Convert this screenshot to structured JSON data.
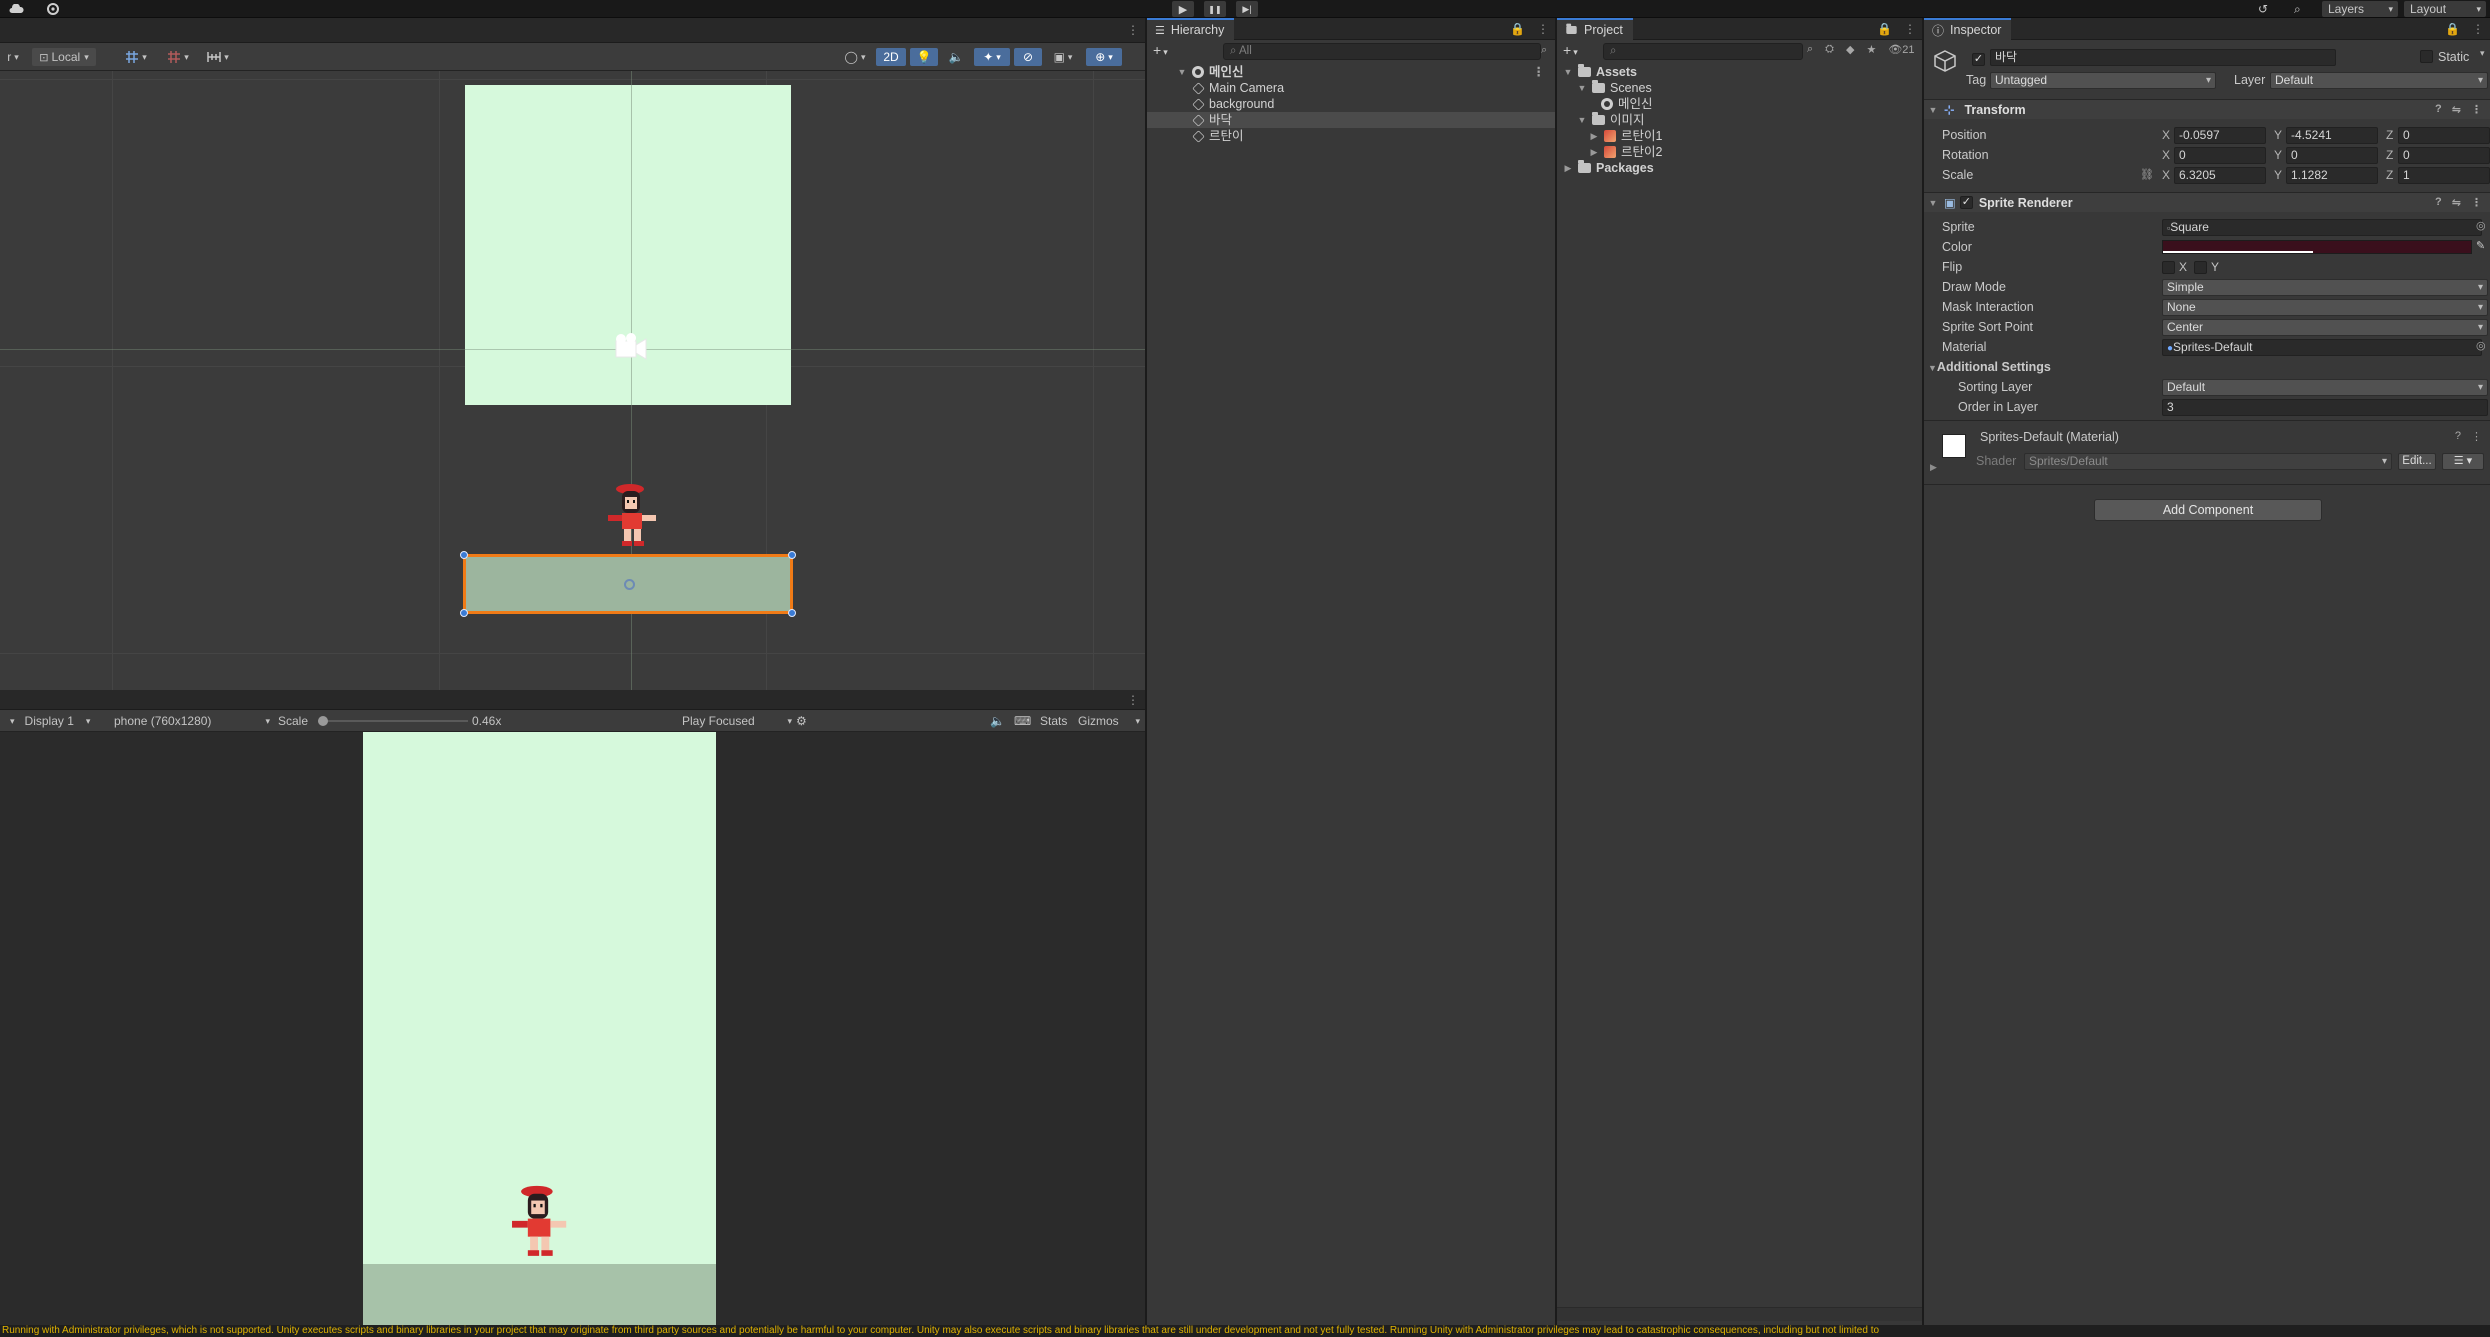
{
  "topbar": {
    "left_icons": [
      "cloud-icon",
      "settings-icon"
    ],
    "play_icon": "▶",
    "pause_icon": "❚❚",
    "step_icon": "▶|",
    "history_icon": "↺",
    "search_icon": "⌕",
    "layers_label": "Layers",
    "layout_label": "Layout"
  },
  "scene": {
    "toolbar": {
      "pivot_partial": "r",
      "local_label": "Local",
      "mode_2d": "2D"
    }
  },
  "game": {
    "display_label": "Display 1",
    "resolution_label": "phone (760x1280)",
    "scale_label": "Scale",
    "scale_value": "0.46x",
    "scale_fraction": 0.0,
    "play_focused_label": "Play Focused",
    "stats_label": "Stats",
    "gizmos_label": "Gizmos"
  },
  "hierarchy": {
    "tab_label": "Hierarchy",
    "search_placeholder": "All",
    "scene_name": "메인신",
    "items": [
      {
        "label": "Main Camera",
        "selected": false
      },
      {
        "label": "background",
        "selected": false
      },
      {
        "label": "바닥",
        "selected": true
      },
      {
        "label": "르탄이",
        "selected": false
      }
    ]
  },
  "project": {
    "tab_label": "Project",
    "hidden_count": "21",
    "tree": {
      "assets": "Assets",
      "scenes": "Scenes",
      "scene_file": "메인신",
      "images": "이미지",
      "image_files": [
        "르탄이1",
        "르탄이2"
      ],
      "packages": "Packages"
    }
  },
  "inspector": {
    "tab_label": "Inspector",
    "object_name": "바닥",
    "static_label": "Static",
    "tag_label": "Tag",
    "tag_value": "Untagged",
    "layer_label": "Layer",
    "layer_value": "Default",
    "transform": {
      "title": "Transform",
      "position_label": "Position",
      "rotation_label": "Rotation",
      "scale_label": "Scale",
      "position": {
        "x": "-0.0597",
        "y": "-4.5241",
        "z": "0"
      },
      "rotation": {
        "x": "0",
        "y": "0",
        "z": "0"
      },
      "scale": {
        "x": "6.3205",
        "y": "1.1282",
        "z": "1"
      }
    },
    "sprite_renderer": {
      "title": "Sprite Renderer",
      "sprite_label": "Sprite",
      "sprite_value": "Square",
      "color_label": "Color",
      "color_hex": "#3a0f1c",
      "flip_label": "Flip",
      "flip_x": "X",
      "flip_y": "Y",
      "draw_mode_label": "Draw Mode",
      "draw_mode_value": "Simple",
      "mask_label": "Mask Interaction",
      "mask_value": "None",
      "sort_point_label": "Sprite Sort Point",
      "sort_point_value": "Center",
      "material_label": "Material",
      "material_value": "Sprites-Default",
      "additional_label": "Additional Settings",
      "sorting_layer_label": "Sorting Layer",
      "sorting_layer_value": "Default",
      "order_label": "Order in Layer",
      "order_value": "3"
    },
    "material": {
      "title": "Sprites-Default (Material)",
      "shader_label": "Shader",
      "shader_value": "Sprites/Default",
      "edit_label": "Edit..."
    },
    "add_component_label": "Add Component"
  },
  "status": {
    "message": "Running with Administrator privileges, which is not supported. Unity executes scripts and binary libraries in your project that may originate from third party sources and potentially be harmful to your computer. Unity may also execute scripts and binary libraries that are still under development and not yet fully tested. Running Unity with Administrator privileges may lead to catastrophic consequences, including but not limited to"
  },
  "colors": {
    "sky": "#d6f9dc",
    "ground_scene": "#9cb59e",
    "ground_game": "#a7c2a9",
    "selection": "#f07b17",
    "accent": "#3a7bd5"
  }
}
